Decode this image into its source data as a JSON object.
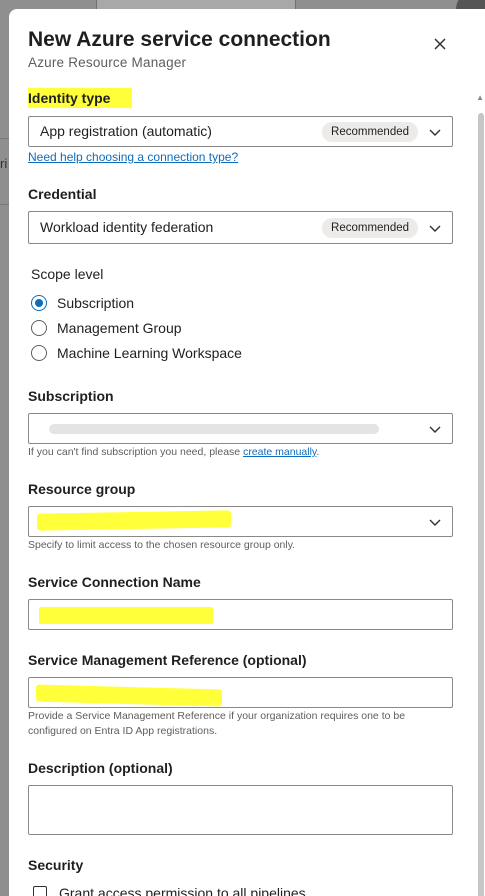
{
  "dialog": {
    "title": "New Azure service connection",
    "subtitle": "Azure Resource Manager"
  },
  "identity_type": {
    "label": "Identity type",
    "value": "App registration (automatic)",
    "badge": "Recommended",
    "help_link": "Need help choosing a connection type?"
  },
  "credential": {
    "label": "Credential",
    "value": "Workload identity federation",
    "badge": "Recommended"
  },
  "scope_level": {
    "label": "Scope level",
    "options": [
      {
        "label": "Subscription",
        "checked": true
      },
      {
        "label": "Management Group",
        "checked": false
      },
      {
        "label": "Machine Learning Workspace",
        "checked": false
      }
    ]
  },
  "subscription": {
    "label": "Subscription",
    "hint_prefix": "If you can't find subscription you need, please ",
    "hint_link": "create manually",
    "hint_suffix": "."
  },
  "resource_group": {
    "label": "Resource group",
    "hint": "Specify to limit access to the chosen resource group only."
  },
  "service_connection_name": {
    "label": "Service Connection Name"
  },
  "service_management_reference": {
    "label": "Service Management Reference (optional)",
    "hint": "Provide a Service Management Reference if your organization requires one to be configured on Entra ID App registrations."
  },
  "description": {
    "label": "Description (optional)"
  },
  "security": {
    "label": "Security",
    "checkbox_label": "Grant access permission to all pipelines"
  },
  "background": {
    "peek_text": "ri"
  },
  "colors": {
    "highlight": "#ffff3a",
    "accent": "#0f6cbd"
  }
}
